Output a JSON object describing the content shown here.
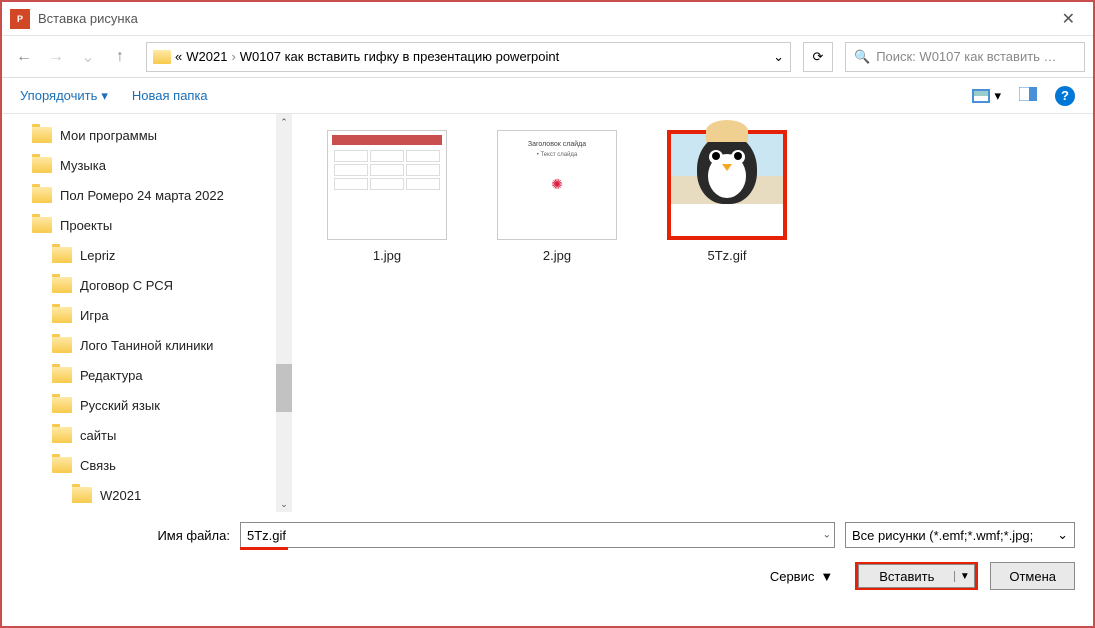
{
  "title": "Вставка рисунка",
  "app_badge": "P",
  "nav": {
    "back": "←",
    "fwd": "→",
    "up": "↑",
    "refresh": "⟳",
    "search_icon": "🔍"
  },
  "breadcrumb": {
    "prefix": "«",
    "items": [
      "W2021",
      "W0107 как вставить гифку в презентацию powerpoint"
    ],
    "sep": "›",
    "chev": "⌄"
  },
  "search": {
    "placeholder": "Поиск: W0107 как вставить …"
  },
  "toolbar": {
    "organize": "Упорядочить",
    "new_folder": "Новая папка",
    "help": "?"
  },
  "sidebar": {
    "items": [
      {
        "label": "Мои программы",
        "cls": ""
      },
      {
        "label": "Музыка",
        "cls": ""
      },
      {
        "label": "Пол Ромеро 24 марта 2022",
        "cls": ""
      },
      {
        "label": "Проекты",
        "cls": ""
      },
      {
        "label": "Lepriz",
        "cls": "sub"
      },
      {
        "label": "Договор С РСЯ",
        "cls": "sub"
      },
      {
        "label": "Игра",
        "cls": "sub"
      },
      {
        "label": "Лого Таниной клиники",
        "cls": "sub"
      },
      {
        "label": "Редактура",
        "cls": "sub"
      },
      {
        "label": "Русский язык",
        "cls": "sub"
      },
      {
        "label": "сайты",
        "cls": "sub"
      },
      {
        "label": "Связь",
        "cls": "sub"
      },
      {
        "label": "W2021",
        "cls": "sub2"
      }
    ]
  },
  "files": [
    {
      "name": "1.jpg",
      "kind": "doc",
      "selected": false
    },
    {
      "name": "2.jpg",
      "kind": "blank",
      "selected": false
    },
    {
      "name": "5Tz.gif",
      "kind": "penguin",
      "selected": true
    }
  ],
  "bottom": {
    "filename_label": "Имя файла:",
    "filename_value": "5Tz.gif",
    "filter": "Все рисунки (*.emf;*.wmf;*.jpg;",
    "service": "Сервис",
    "insert": "Вставить",
    "cancel": "Отмена"
  },
  "glyph": {
    "dd": "▾",
    "dd_sm": "▼",
    "up": "⌃",
    "down": "⌄"
  }
}
